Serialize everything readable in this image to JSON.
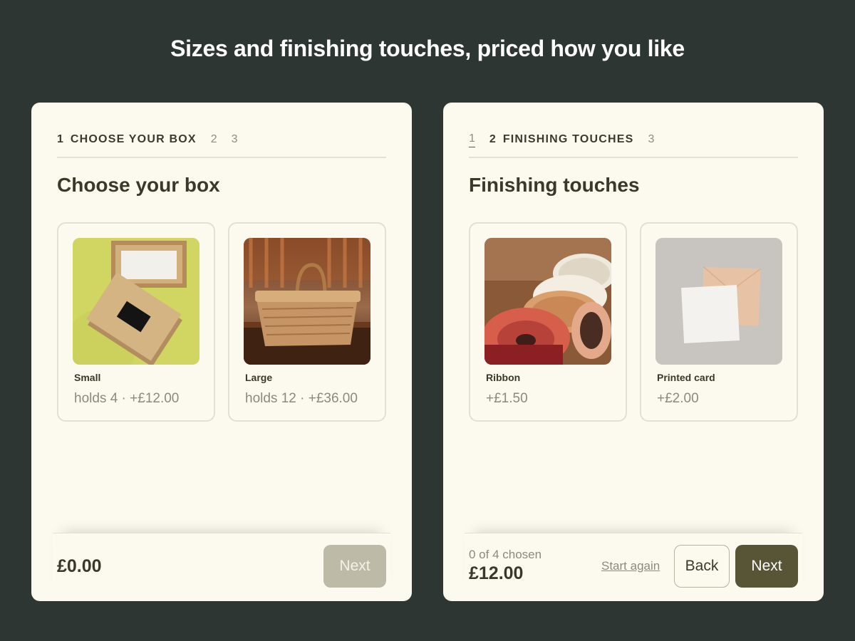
{
  "headline": "Sizes and finishing touches, priced how you like",
  "left_panel": {
    "steps": {
      "active_number": "1",
      "active_label": "CHOOSE YOUR BOX",
      "step2": "2",
      "step3": "3"
    },
    "title": "Choose your box",
    "options": [
      {
        "name": "Small",
        "meta": "holds 4 · +£12.00",
        "image": "kraft-box-photo"
      },
      {
        "name": "Large",
        "meta": "holds 12 · +£36.00",
        "image": "wicker-basket-photo"
      }
    ],
    "footer": {
      "total": "£0.00",
      "next_label": "Next"
    }
  },
  "right_panel": {
    "steps": {
      "step1": "1",
      "active_number": "2",
      "active_label": "FINISHING TOUCHES",
      "step3": "3"
    },
    "title": "Finishing touches",
    "options": [
      {
        "name": "Ribbon",
        "meta": "+£1.50",
        "image": "ribbon-spools-photo"
      },
      {
        "name": "Printed card",
        "meta": "+£2.00",
        "image": "printed-card-photo"
      }
    ],
    "footer": {
      "chosen": "0 of 4 chosen",
      "total": "£12.00",
      "start_again_label": "Start again",
      "back_label": "Back",
      "next_label": "Next"
    }
  },
  "colors": {
    "background": "#2d3632",
    "panel": "#fcf9ee",
    "accent": "#575536",
    "disabled": "#bdbba8"
  }
}
